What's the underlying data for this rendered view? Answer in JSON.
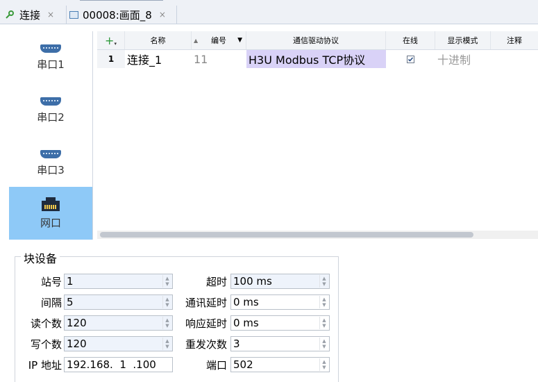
{
  "tabs": [
    {
      "label": "连接",
      "close": "×"
    },
    {
      "label": "00008:画面_8",
      "close": "×"
    }
  ],
  "nav": [
    {
      "label": "串口1",
      "icon": "serial-port-icon"
    },
    {
      "label": "串口2",
      "icon": "serial-port-icon"
    },
    {
      "label": "串口3",
      "icon": "serial-port-icon"
    },
    {
      "label": "网口",
      "icon": "ethernet-port-icon",
      "active": true
    }
  ],
  "table": {
    "add_symbol": "+",
    "headers": [
      "名称",
      "编号",
      "通信驱动协议",
      "在线",
      "显示模式",
      "注释"
    ],
    "rows": [
      {
        "index": "1",
        "name": "连接_1",
        "number": "11",
        "protocol": "H3U Modbus TCP协议",
        "online": true,
        "mode": "十进制",
        "note": ""
      }
    ]
  },
  "block": {
    "title": "块设备",
    "left": [
      {
        "label": "站号",
        "value": "1"
      },
      {
        "label": "间隔",
        "value": "5"
      },
      {
        "label": "读个数",
        "value": "120"
      },
      {
        "label": "写个数",
        "value": "120"
      },
      {
        "label": "IP 地址",
        "value": "192.168.  1  .100"
      }
    ],
    "right": [
      {
        "label": "超时",
        "value": "100 ms"
      },
      {
        "label": "通讯延时",
        "value": "0 ms"
      },
      {
        "label": "响应延时",
        "value": "0 ms"
      },
      {
        "label": "重发次数",
        "value": "3"
      },
      {
        "label": "端口",
        "value": "502"
      }
    ]
  },
  "colors": {
    "accent": "#8ec9f7",
    "protocol_bg": "#d9d2f7"
  }
}
